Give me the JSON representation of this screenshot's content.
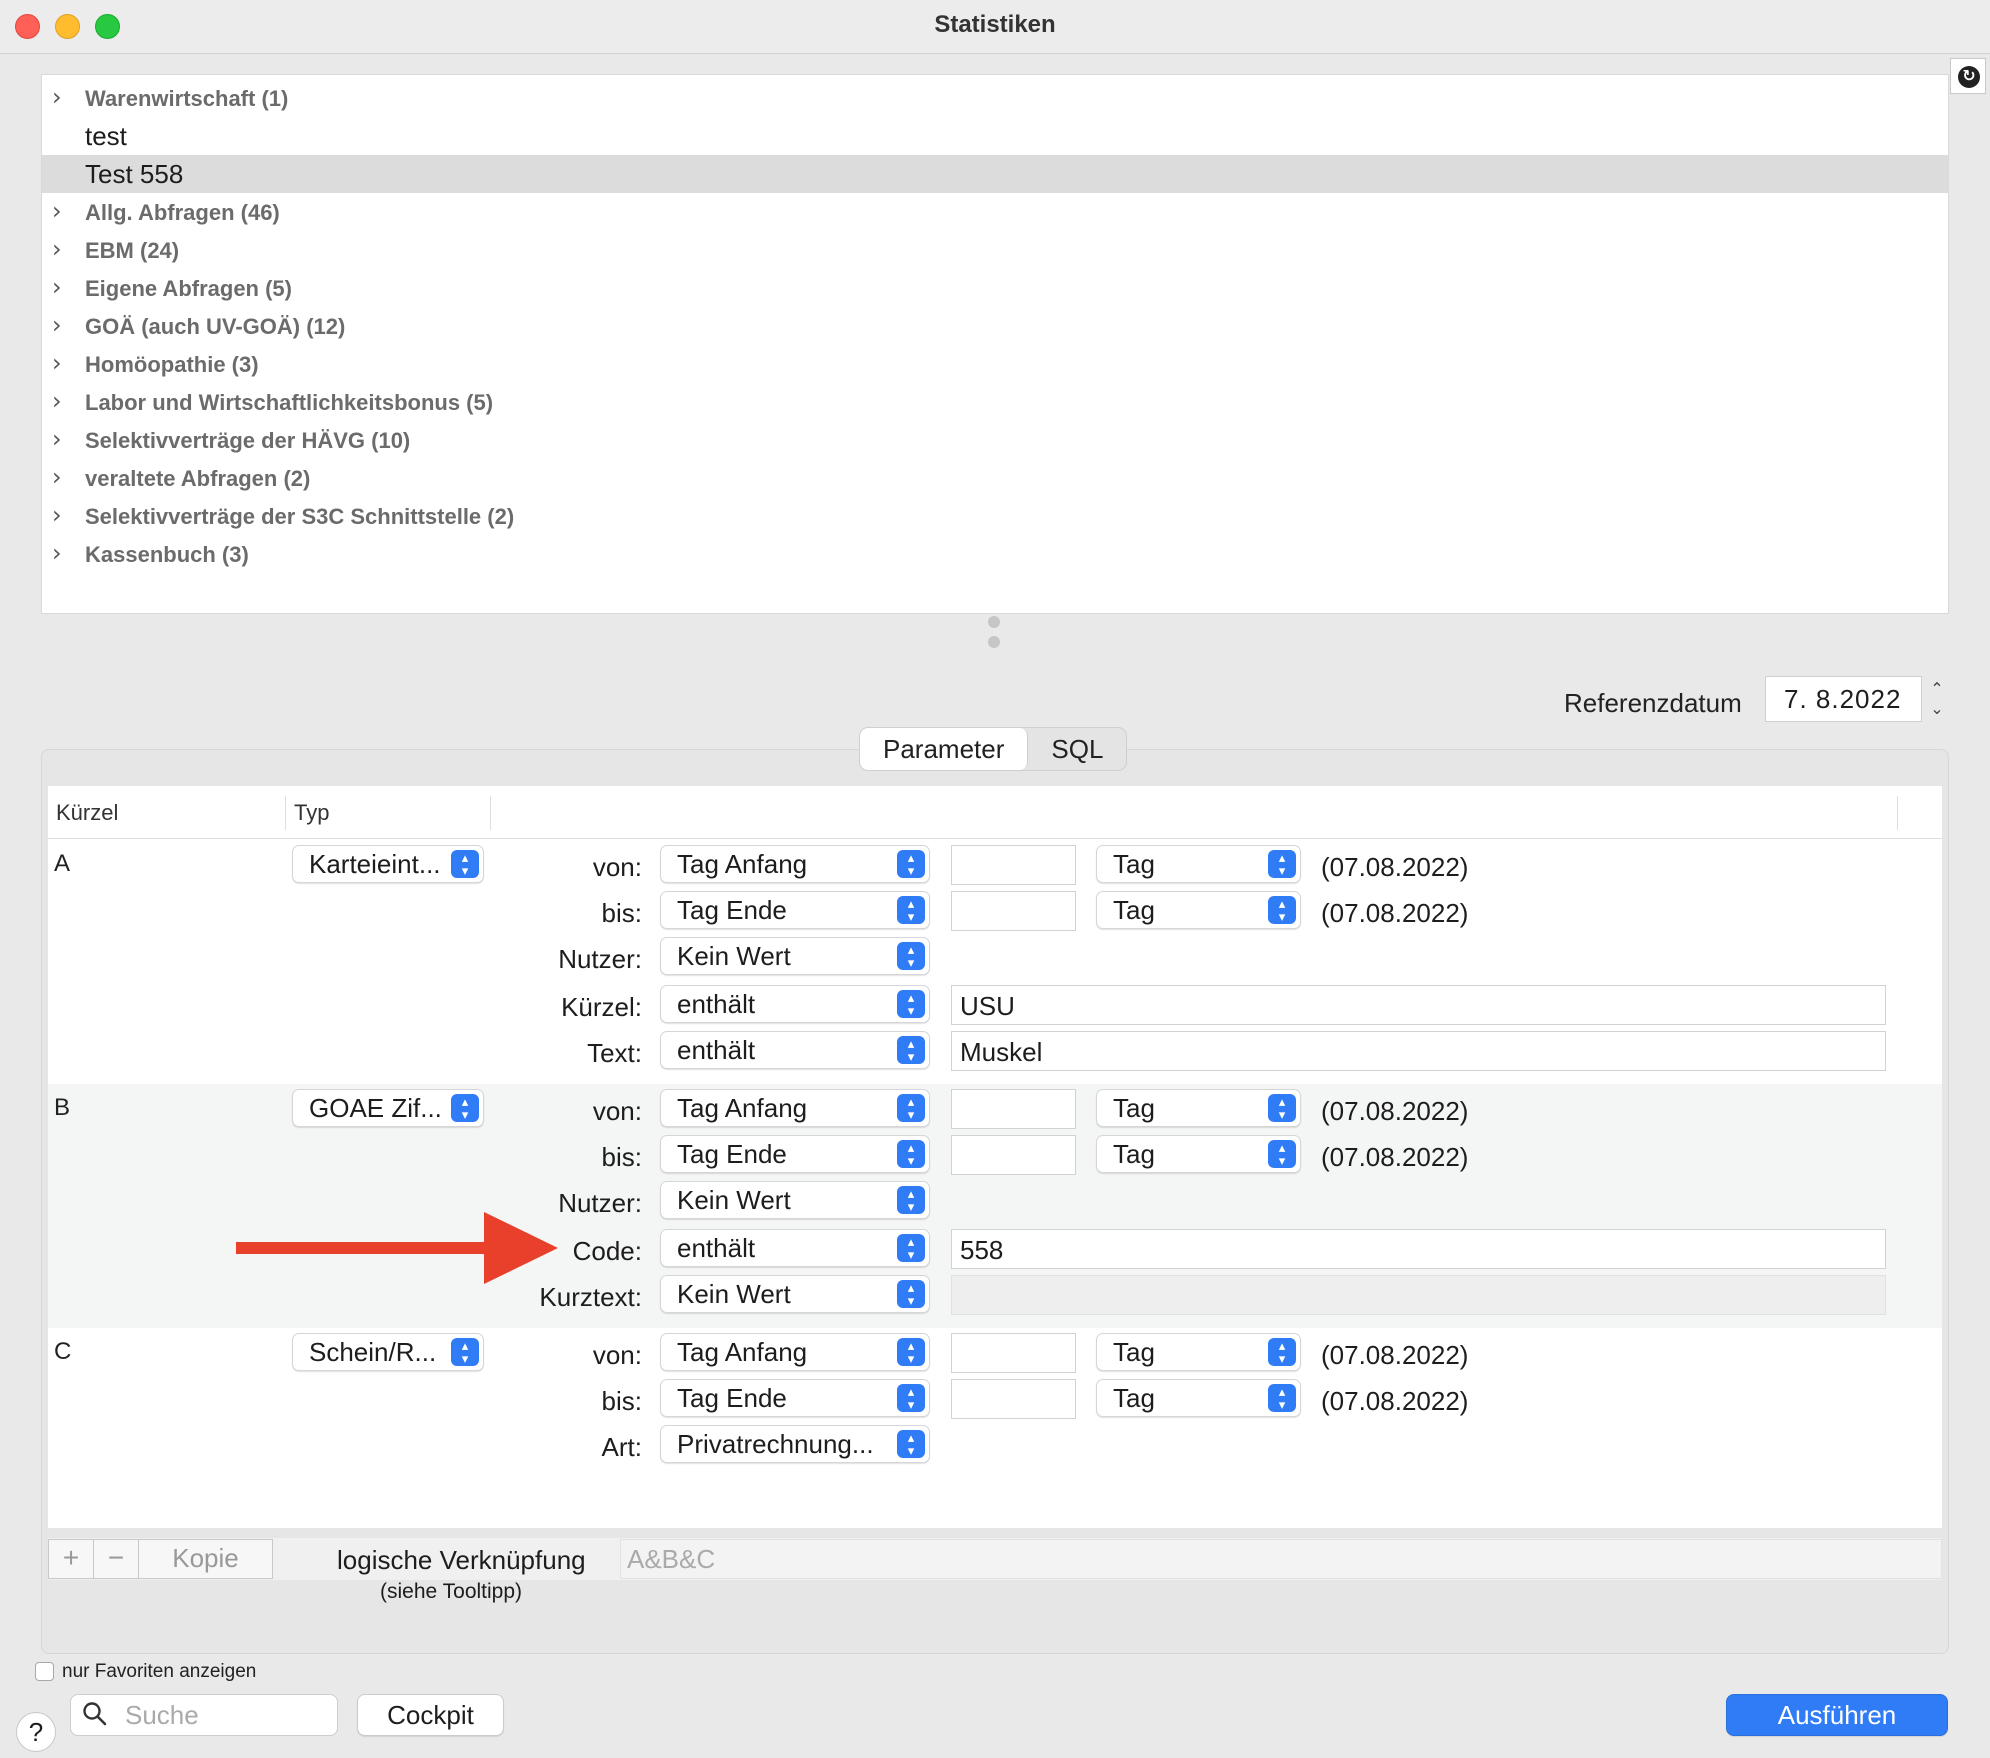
{
  "window": {
    "title": "Statistiken"
  },
  "tree": {
    "items": [
      {
        "label": "Warenwirtschaft (1)",
        "expandable": true
      },
      {
        "label": "test",
        "expandable": false
      },
      {
        "label": "Test 558",
        "expandable": false,
        "selected": true
      },
      {
        "label": "Allg. Abfragen (46)",
        "expandable": true
      },
      {
        "label": "EBM (24)",
        "expandable": true
      },
      {
        "label": "Eigene Abfragen (5)",
        "expandable": true
      },
      {
        "label": "GOÄ (auch UV-GOÄ) (12)",
        "expandable": true
      },
      {
        "label": "Homöopathie (3)",
        "expandable": true
      },
      {
        "label": "Labor und Wirtschaftlichkeitsbonus (5)",
        "expandable": true
      },
      {
        "label": "Selektivverträge der HÄVG (10)",
        "expandable": true
      },
      {
        "label": "veraltete Abfragen (2)",
        "expandable": true
      },
      {
        "label": "Selektivverträge der S3C Schnittstelle (2)",
        "expandable": true
      },
      {
        "label": "Kassenbuch (3)",
        "expandable": true
      }
    ]
  },
  "reference": {
    "label": "Referenzdatum",
    "value": "7.  8.2022"
  },
  "tabs": {
    "parameter": "Parameter",
    "sql": "SQL"
  },
  "table": {
    "col_kuerzel": "Kürzel",
    "col_typ": "Typ",
    "groups": [
      {
        "key": "A",
        "type": "Karteieint...",
        "von": {
          "label": "von:",
          "select": "Tag Anfang",
          "unit": "Tag",
          "date": "(07.08.2022)"
        },
        "bis": {
          "label": "bis:",
          "select": "Tag Ende",
          "unit": "Tag",
          "date": "(07.08.2022)"
        },
        "nutzer": {
          "label": "Nutzer:",
          "select": "Kein Wert"
        },
        "row4": {
          "label": "Kürzel:",
          "select": "enthält",
          "value": "USU"
        },
        "row5": {
          "label": "Text:",
          "select": "enthält",
          "value": "Muskel"
        }
      },
      {
        "key": "B",
        "type": "GOAE Zif...",
        "von": {
          "label": "von:",
          "select": "Tag Anfang",
          "unit": "Tag",
          "date": "(07.08.2022)"
        },
        "bis": {
          "label": "bis:",
          "select": "Tag Ende",
          "unit": "Tag",
          "date": "(07.08.2022)"
        },
        "nutzer": {
          "label": "Nutzer:",
          "select": "Kein Wert"
        },
        "row4": {
          "label": "Code:",
          "select": "enthält",
          "value": "558"
        },
        "row5": {
          "label": "Kurztext:",
          "select": "Kein Wert",
          "value": ""
        }
      },
      {
        "key": "C",
        "type": "Schein/R...",
        "von": {
          "label": "von:",
          "select": "Tag Anfang",
          "unit": "Tag",
          "date": "(07.08.2022)"
        },
        "bis": {
          "label": "bis:",
          "select": "Tag Ende",
          "unit": "Tag",
          "date": "(07.08.2022)"
        },
        "art": {
          "label": "Art:",
          "select": "Privatrechnung..."
        }
      }
    ]
  },
  "footer": {
    "plus": "+",
    "minus": "−",
    "copy": "Kopie",
    "logic_label": "logische Verknüpfung",
    "logic_sub": "(siehe Tooltipp)",
    "logic_placeholder": "A&B&C"
  },
  "bottom": {
    "favorites_label": "nur Favoriten anzeigen",
    "search_placeholder": "Suche",
    "cockpit": "Cockpit",
    "run": "Ausführen",
    "help": "?"
  },
  "annotation": {
    "arrow_color": "#e8402a"
  },
  "colors": {
    "accent": "#2f7cf6",
    "selected_row": "#dcdcdc"
  }
}
